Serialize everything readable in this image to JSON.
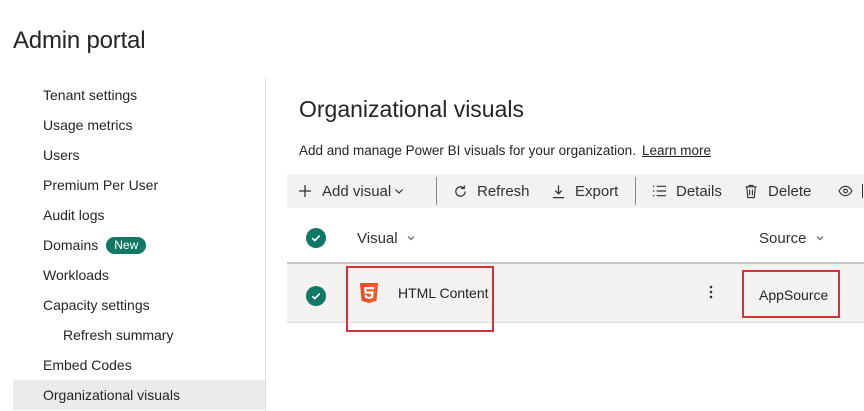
{
  "app": {
    "title": "Admin portal"
  },
  "sidebar": {
    "items": [
      {
        "label": "Tenant settings"
      },
      {
        "label": "Usage metrics"
      },
      {
        "label": "Users"
      },
      {
        "label": "Premium Per User"
      },
      {
        "label": "Audit logs"
      },
      {
        "label": "Domains",
        "badge": "New"
      },
      {
        "label": "Workloads"
      },
      {
        "label": "Capacity settings"
      },
      {
        "label": "Refresh summary"
      },
      {
        "label": "Embed Codes"
      },
      {
        "label": "Organizational visuals",
        "selected": true
      }
    ]
  },
  "main": {
    "title": "Organizational visuals",
    "description": "Add and manage Power BI visuals for your organization.",
    "learn_more": "Learn more"
  },
  "toolbar": {
    "add_visual": "Add visual",
    "refresh": "Refresh",
    "export": "Export",
    "details": "Details",
    "delete": "Delete"
  },
  "table": {
    "columns": [
      "Visual",
      "Source"
    ],
    "rows": [
      {
        "visual": "HTML Content",
        "source": "AppSource",
        "icon": "html5-icon",
        "selected": true
      }
    ]
  },
  "colors": {
    "accent": "#117865",
    "highlight": "#d13438",
    "html5": "#e44d26"
  }
}
